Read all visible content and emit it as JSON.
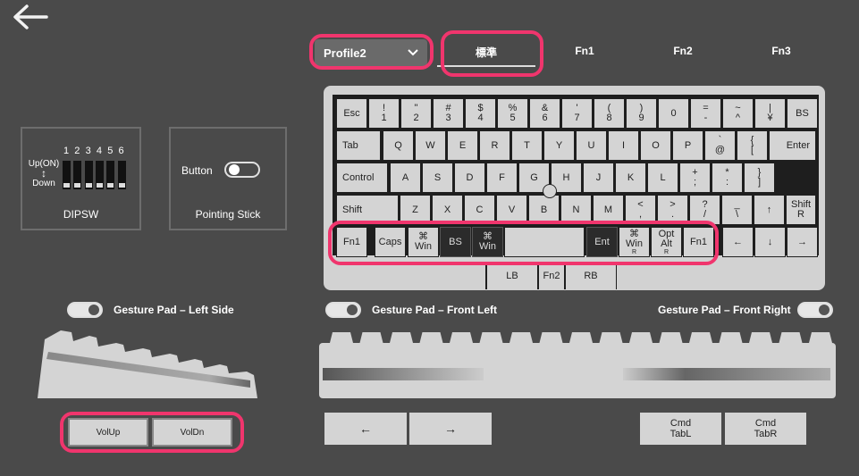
{
  "header": {
    "profile_label": "Profile2",
    "tabs": [
      "標準",
      "Fn1",
      "Fn2",
      "Fn3"
    ]
  },
  "dipsw": {
    "numbers": [
      "1",
      "2",
      "3",
      "4",
      "5",
      "6"
    ],
    "up_label": "Up(ON)",
    "arrow": "↕",
    "down_label": "Down",
    "title": "DIPSW"
  },
  "pointing_stick": {
    "button_label": "Button",
    "title": "Pointing Stick"
  },
  "gesture": {
    "left_side": "Gesture Pad – Left Side",
    "front_left": "Gesture Pad – Front Left",
    "front_right": "Gesture Pad – Front Right"
  },
  "keyboard": {
    "row1": [
      {
        "t": "Esc",
        "b": ""
      },
      {
        "t": "!",
        "b": "1"
      },
      {
        "t": "\"",
        "b": "2"
      },
      {
        "t": "#",
        "b": "3"
      },
      {
        "t": "$",
        "b": "4"
      },
      {
        "t": "%",
        "b": "5"
      },
      {
        "t": "&",
        "b": "6"
      },
      {
        "t": "'",
        "b": "7"
      },
      {
        "t": "(",
        "b": "8"
      },
      {
        "t": ")",
        "b": "9"
      },
      {
        "t": "",
        "b": "0"
      },
      {
        "t": "=",
        "b": "-"
      },
      {
        "t": "~",
        "b": "^"
      },
      {
        "t": "|",
        "b": "¥"
      },
      {
        "t": "BS",
        "b": ""
      }
    ],
    "row2": [
      "Tab",
      "Q",
      "W",
      "E",
      "R",
      "T",
      "Y",
      "U",
      "I",
      "O",
      "P",
      "`\n@",
      "{\n[",
      "Enter"
    ],
    "row3": [
      "Control",
      "A",
      "S",
      "D",
      "F",
      "G",
      "H",
      "J",
      "K",
      "L",
      "+\n;",
      "*\n:",
      "}\n]"
    ],
    "row4": [
      "Shift",
      "Z",
      "X",
      "C",
      "V",
      "B",
      "N",
      "M",
      "<\n,",
      ">\n.",
      "?\n/",
      "_\n\\",
      "↑",
      "Shift\nR"
    ],
    "row5": [
      "Fn1",
      "Caps",
      "⌘\nWin",
      "BS",
      "⌘\nWin",
      "",
      "Ent",
      "⌘\nWin\nR",
      "Opt\nAlt\nR",
      "Fn1",
      "←",
      "↓",
      "→"
    ],
    "thumb": [
      "LB",
      "Fn2",
      "RB"
    ]
  },
  "bottom": {
    "vol_up": "VolUp",
    "vol_dn": "VolDn",
    "left_arrow": "←",
    "right_arrow": "→",
    "cmd_tabl": [
      "Cmd",
      "TabL"
    ],
    "cmd_tabr": [
      "Cmd",
      "TabR"
    ]
  },
  "colors": {
    "highlight": "#f0356d",
    "background": "#4a4a4a",
    "key": "#d4d4d4"
  }
}
